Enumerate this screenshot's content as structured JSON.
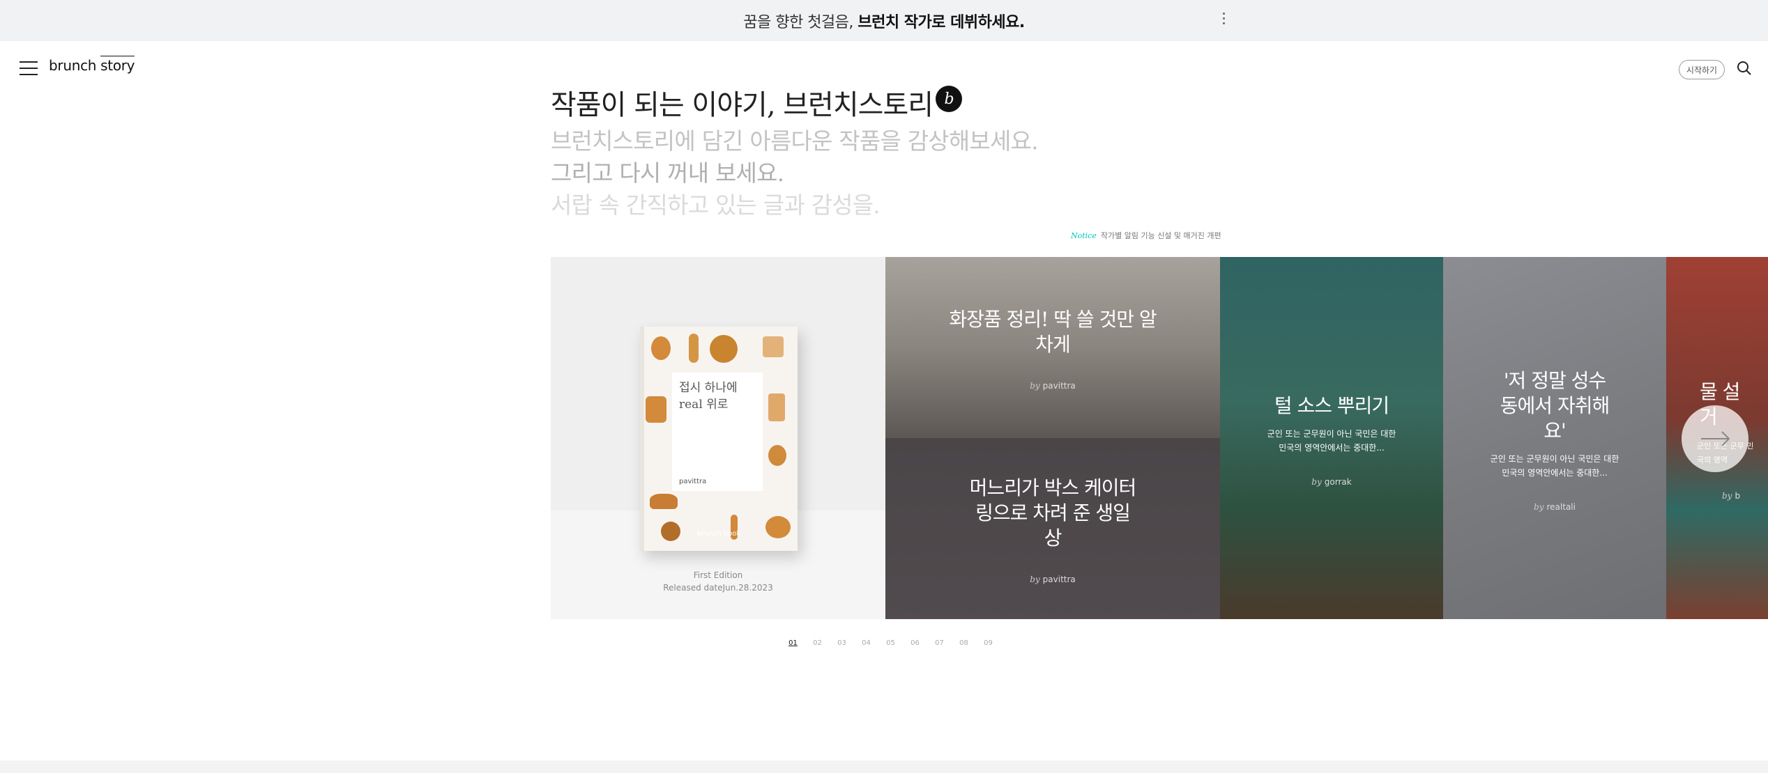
{
  "banner": {
    "text_plain": "꿈을 향한 첫걸음, ",
    "text_bold": "브런치 작가로 데뷔하세요."
  },
  "header": {
    "logo_left": "brunch",
    "logo_right": "story",
    "start_label": "시작하기"
  },
  "hero": {
    "title": "작품이 되는 이야기, 브런치스토리",
    "badge": "b",
    "sub1": "브런치스토리에 담긴 아름다운 작품을 감상해보세요.",
    "sub2": "그리고 다시 꺼내 보세요.",
    "sub3": "서랍 속 간직하고 있는 글과 감성을."
  },
  "notice": {
    "label": "Notice",
    "text": "작가별 알림 기능 신설 및 매거진 개편"
  },
  "cards": [
    {
      "book_title": "접시 하나에 real 위로",
      "book_author": "pavittra",
      "book_brand": "brunch book",
      "edition": "First Edition",
      "released": "Released dateJun.28.2023"
    },
    {
      "title": "화장품 정리! 딱 쓸 것만 알차게",
      "by": "by",
      "author": "pavittra"
    },
    {
      "title": "머느리가 박스 케이터링으로 차려 준 생일상",
      "by": "by",
      "author": "pavittra"
    },
    {
      "title": "털 소스 뿌리기",
      "desc": "군인 또는 군무원이 아닌 국민은 대한민국의 영역안에서는 중대한...",
      "by": "by",
      "author": "gorrak"
    },
    {
      "title": "'저 정말 성수동에서 자취해요'",
      "desc": "군인 또는 군무원이 아닌 국민은 대한민국의 영역안에서는 중대한...",
      "by": "by",
      "author": "realtali"
    },
    {
      "title": "물 설거",
      "desc": "군인 또는 군무 민국의 영역",
      "by": "by",
      "author": "b"
    }
  ],
  "pager": [
    "01",
    "02",
    "03",
    "04",
    "05",
    "06",
    "07",
    "08",
    "09"
  ],
  "colors": {
    "accent": "#00c6be",
    "banner_bg": "#f1f2f4"
  }
}
